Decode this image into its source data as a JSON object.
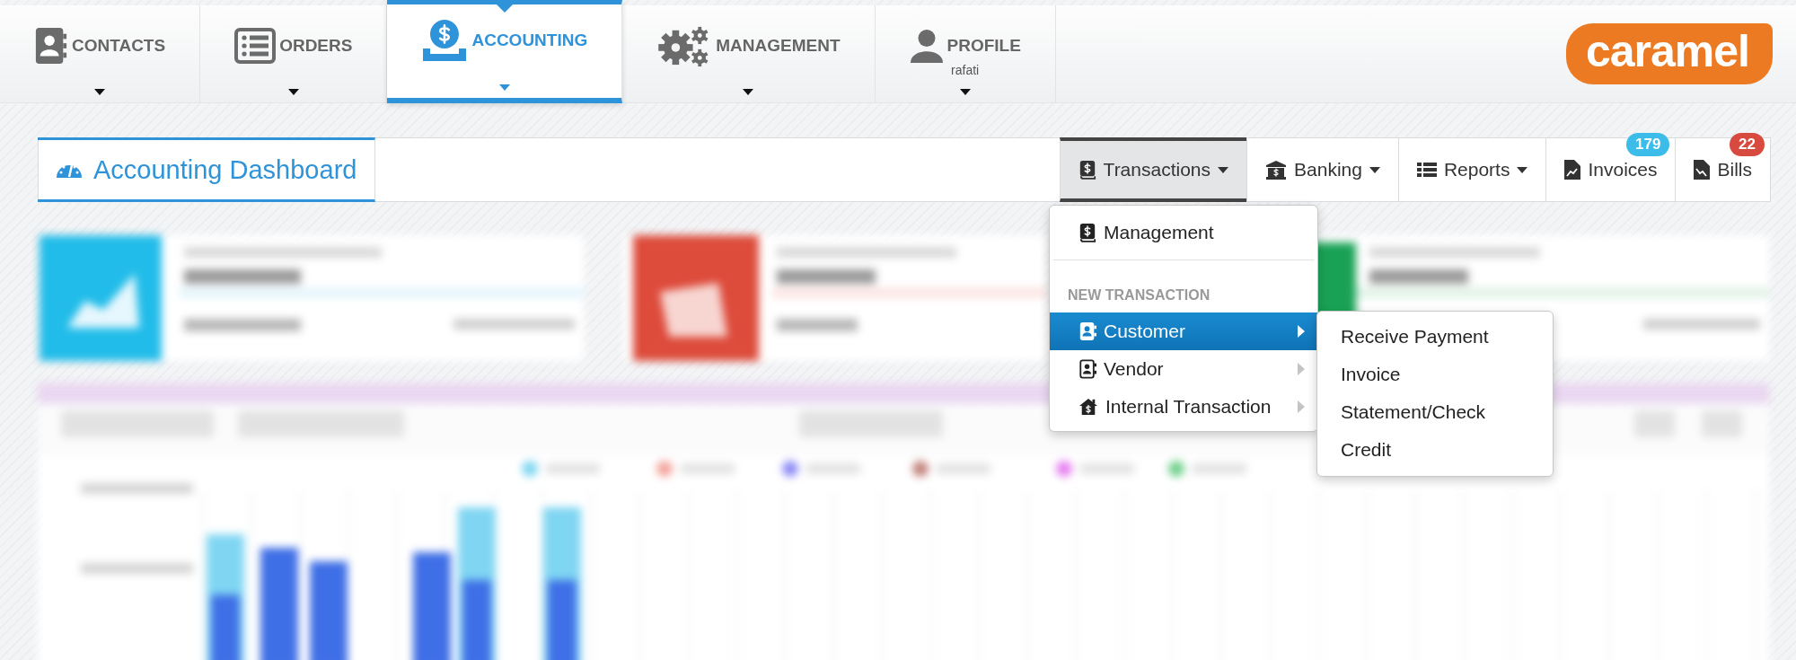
{
  "nav": [
    {
      "label": "CONTACTS",
      "selected": false
    },
    {
      "label": "ORDERS",
      "selected": false
    },
    {
      "label": "ACCOUNTING",
      "selected": true
    },
    {
      "label": "MANAGEMENT",
      "selected": false
    },
    {
      "label": "PROFILE",
      "sublabel": "rafati",
      "selected": false
    }
  ],
  "logo": "caramel",
  "page_title": "Accounting Dashboard",
  "toolbar": [
    {
      "label": "Transactions",
      "dropdown": true,
      "selected": true
    },
    {
      "label": "Banking",
      "dropdown": true,
      "selected": false
    },
    {
      "label": "Reports",
      "dropdown": true,
      "selected": false
    },
    {
      "label": "Invoices",
      "dropdown": false,
      "selected": false,
      "badge": {
        "text": "179",
        "color": "#3bbce9"
      }
    },
    {
      "label": "Bills",
      "dropdown": false,
      "selected": false,
      "badge": {
        "text": "22",
        "color": "#d84a3f"
      }
    }
  ],
  "menu": [
    {
      "kind": "item",
      "label": "Management"
    },
    {
      "kind": "header",
      "label": "NEW TRANSACTION"
    },
    {
      "kind": "submenu",
      "label": "Customer",
      "selected": true
    },
    {
      "kind": "submenu",
      "label": "Vendor",
      "selected": false
    },
    {
      "kind": "submenu",
      "label": "Internal Transaction",
      "selected": false
    }
  ],
  "submenu": [
    "Receive Payment",
    "Invoice",
    "Statement/Check",
    "Credit"
  ]
}
